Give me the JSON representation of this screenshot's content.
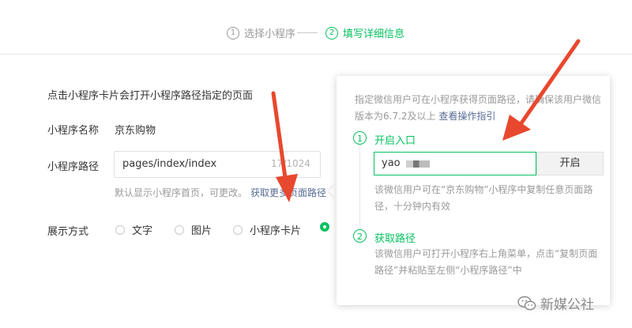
{
  "stepper": {
    "step1": {
      "num": "1",
      "label": "选择小程序"
    },
    "step2": {
      "num": "2",
      "label": "填写详细信息"
    }
  },
  "form": {
    "description": "点击小程序卡片会打开小程序路径指定的页面",
    "name_label": "小程序名称",
    "name_value": "京东购物",
    "path_label": "小程序路径",
    "path_value": "pages/index/index",
    "path_counter": "17/1024",
    "hint": "默认显示小程序首页，可更改。",
    "hint_link": "获取更多页面路径",
    "display_label": "展示方式",
    "display_options": [
      "文字",
      "图片",
      "小程序卡片",
      ""
    ]
  },
  "popover": {
    "intro_text": "指定微信用户可在小程序获得页面路径，请确保该用户微信版本为6.7.2及以上 ",
    "intro_link": "查看操作指引",
    "step1_num": "1",
    "step1_title": "开启入口",
    "input_value": "yao",
    "enable_button": "开启",
    "step1_desc": "该微信用户可在“京东购物”小程序中复制任意页面路径，十分钟内有效",
    "step2_num": "2",
    "step2_title": "获取路径",
    "step2_desc": "该微信用户可打开小程序右上角菜单，点击“复制页面路径”并粘贴至左侧“小程序路径”中"
  },
  "watermark": {
    "text": "新媒公社",
    "icon": "wechat-icon"
  },
  "colors": {
    "accent": "#07c160",
    "link": "#576b95",
    "arrow": "#e8482d"
  }
}
